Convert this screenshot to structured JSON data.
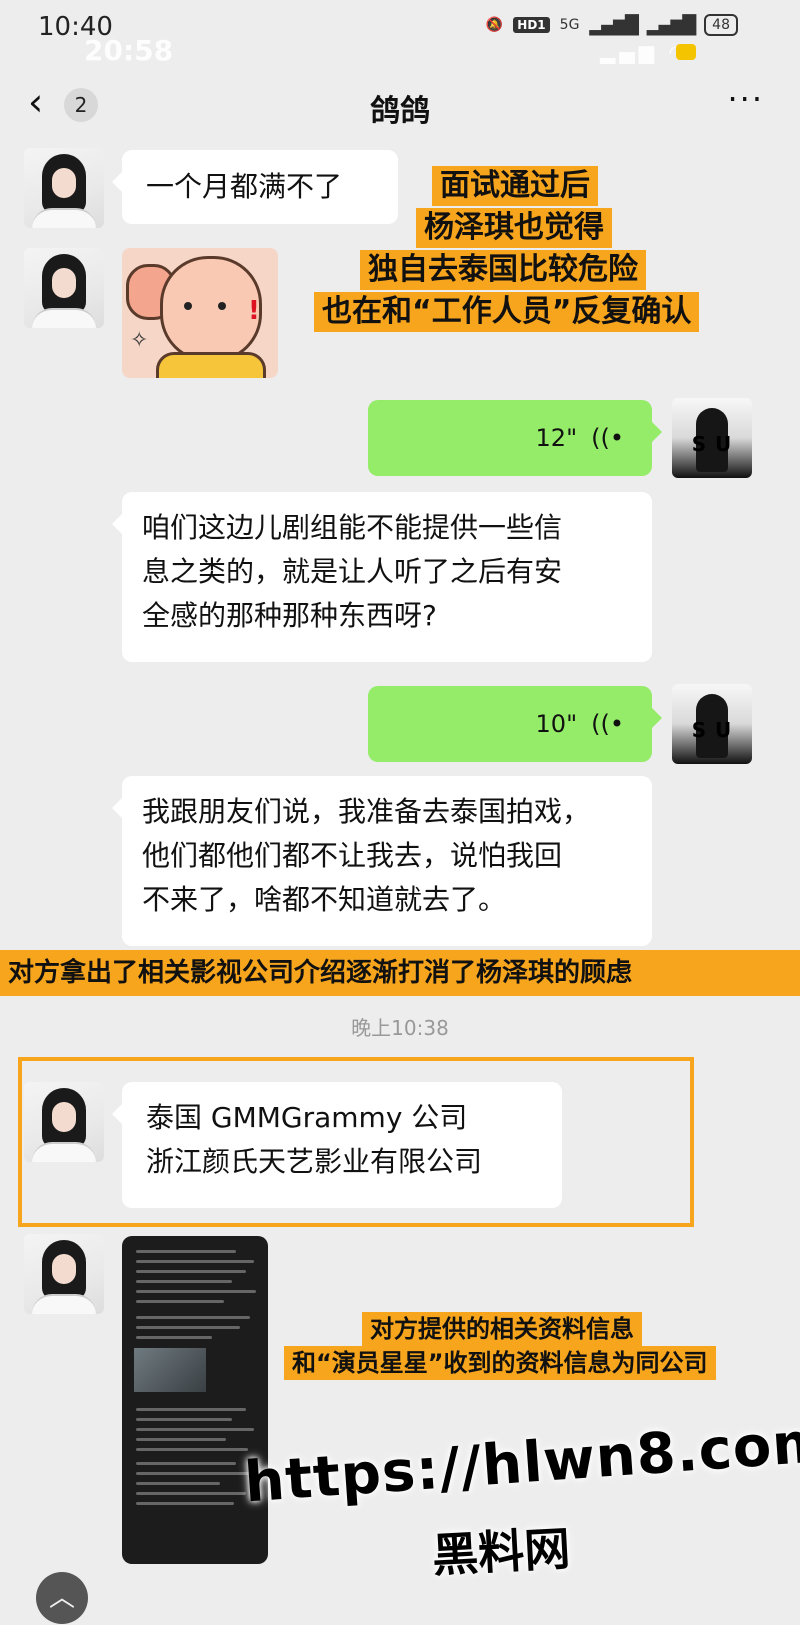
{
  "status_bar": {
    "time": "10:40",
    "ghost_time": "20:58",
    "hd_badge": "HD1",
    "network": "5G",
    "battery": "48"
  },
  "nav": {
    "back_icon": "chevron-left-icon",
    "unread_count": "2",
    "title": "鸽鸽",
    "more_icon": "ellipsis-icon"
  },
  "messages": {
    "m1_text": "一个月都满不了",
    "voice1_duration": "12\"",
    "m3_line1": "咱们这边儿剧组能不能提供一些信",
    "m3_line2": "息之类的，就是让人听了之后有安",
    "m3_line3": "全感的那种那种东西呀?",
    "voice2_duration": "10\"",
    "m5_line1": "我跟朋友们说，我准备去泰国拍戏，",
    "m5_line2": "他们都他们都不让我去，说怕我回",
    "m5_line3": "不来了，啥都不知道就去了。",
    "timestamp": "晚上10:38",
    "m6_line1": "泰国 GMMGrammy 公司",
    "m6_line2": "浙江颜氏天艺影业有限公司"
  },
  "captions": {
    "top": [
      "面试通过后",
      "杨泽琪也觉得",
      "独自去泰国比较危险",
      "也在和“工作人员”反复确认"
    ],
    "middle": "对方拿出了相关影视公司介绍逐渐打消了杨泽琪的顾虑",
    "bottom": [
      "对方提供的相关资料信息",
      "和“演员星星”收到的资料信息为同公司"
    ]
  },
  "avatar_right_text": "S    U",
  "watermark": {
    "url": "https://hlwn8.com",
    "name": "黑料网"
  },
  "colors": {
    "caption_bg": "#f7a51c",
    "bubble_green": "#95ec69",
    "background": "#ededed"
  },
  "bottom_button_icon": "chevron-up-icon",
  "bottom_button_glyph": "︿"
}
